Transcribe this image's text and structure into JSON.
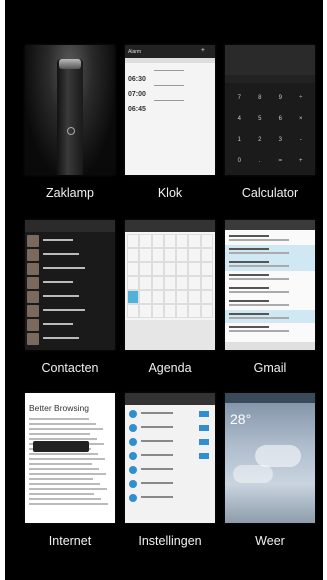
{
  "recent_apps": [
    {
      "name": "Zaklamp",
      "thumb": "flashlight"
    },
    {
      "name": "Klok",
      "thumb": "clock"
    },
    {
      "name": "Calculator",
      "thumb": "calculator"
    },
    {
      "name": "Contacten",
      "thumb": "contacts"
    },
    {
      "name": "Agenda",
      "thumb": "calendar"
    },
    {
      "name": "Gmail",
      "thumb": "gmail"
    },
    {
      "name": "Internet",
      "thumb": "browser"
    },
    {
      "name": "Instellingen",
      "thumb": "settings"
    },
    {
      "name": "Weer",
      "thumb": "weather"
    }
  ],
  "clock": {
    "header": "Alarm",
    "alarms": [
      "06:30",
      "07:00",
      "06:45"
    ]
  },
  "calculator": {
    "keys": [
      "7",
      "8",
      "9",
      "÷",
      "4",
      "5",
      "6",
      "×",
      "1",
      "2",
      "3",
      "-",
      "0",
      ".",
      "=",
      "+"
    ]
  },
  "browser": {
    "title": "Better Browsing"
  },
  "weather": {
    "temp": "28°"
  }
}
